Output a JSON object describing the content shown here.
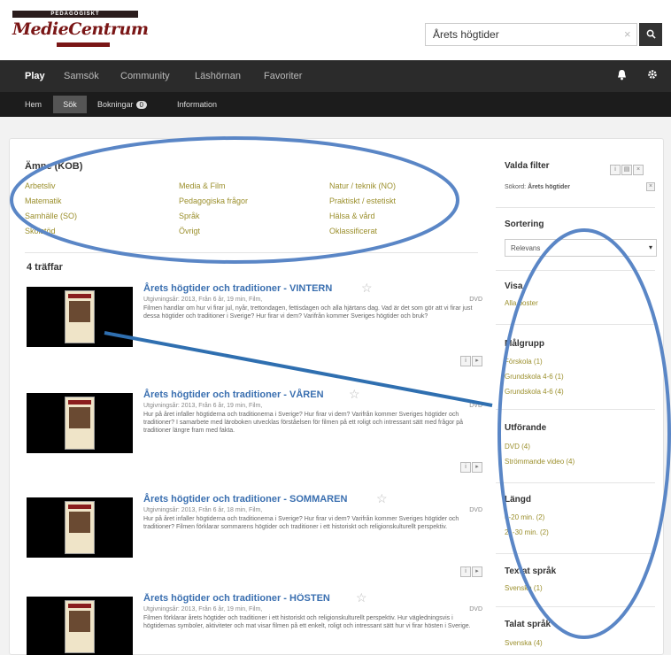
{
  "header": {
    "logo_top": "PEDAGOGISKT",
    "logo_script": "MedieCentrum",
    "search_value": "Årets högtider",
    "search_clear": "×",
    "search_icon": "search-icon"
  },
  "nav": {
    "items": [
      "Play",
      "Samsök",
      "Community",
      "Läshörnan",
      "Favoriter"
    ],
    "bell_icon": "bell-icon",
    "gear_icon": "gear-icon"
  },
  "subnav": {
    "items": [
      "Hem",
      "Sök",
      "Bokningar",
      "Information"
    ],
    "badge": "0"
  },
  "categories": {
    "title": "Ämne (KOB)",
    "links": [
      "Arbetsliv",
      "Media & Film",
      "Natur / teknik (NO)",
      "Matematik",
      "Pedagogiska frågor",
      "Praktiskt / estetiskt",
      "Samhälle (SO)",
      "Språk",
      "Hälsa & vård",
      "Skolstöd",
      "Övrigt",
      "Oklassificerat"
    ]
  },
  "results": {
    "count": "4 träffar",
    "items": [
      {
        "title": "Årets högtider och traditioner - VINTERN",
        "meta": "Utgivningsår: 2013, Från 6 år, 19 min, Film,",
        "dvd": "DVD",
        "desc": "Filmen handlar om hur vi firar jul, nyår, trettondagen, fettisdagen och alla hjärtans dag. Vad är det som gör att vi firar just dessa högtider och traditioner i Sverige? Hur firar vi dem? Varifrån kommer Sveriges högtider och bruk?"
      },
      {
        "title": "Årets högtider och traditioner - VÅREN",
        "meta": "Utgivningsår: 2013, Från 6 år, 19 min, Film,",
        "dvd": "DVD",
        "desc": "Hur på året infaller högtiderna och traditionerna i Sverige? Hur firar vi dem? Varifrån kommer Sveriges högtider och traditioner? I samarbete med läroboken utvecklas förståelsen för filmen på ett roligt och intressant sätt med frågor på traditioner längre fram med fakta."
      },
      {
        "title": "Årets högtider och traditioner - SOMMAREN",
        "meta": "Utgivningsår: 2013, Från 6 år, 18 min, Film,",
        "dvd": "DVD",
        "desc": "Hur på året infaller högtiderna och traditionerna i Sverige? Hur firar vi dem? Varifrån kommer Sveriges högtider och traditioner? Filmen förklarar sommarens högtider och traditioner i ett historiskt och religionskulturellt perspektiv."
      },
      {
        "title": "Årets högtider och traditioner - HÖSTEN",
        "meta": "Utgivningsår: 2013, Från 6 år, 19 min, Film,",
        "dvd": "DVD",
        "desc": "Filmen förklarar årets högtider och traditioner i ett historiskt och religionskulturellt perspektiv. Hur vägledningsvis i högtidernas symboler, aktiviteter och mat visar filmen på ett enkelt, roligt och intressant sätt hur vi firar hösten i Sverige."
      }
    ]
  },
  "sidebar": {
    "filters_title": "Valda filter",
    "filter_label": "Sökord:",
    "filter_value": "Årets högtider",
    "sort_title": "Sortering",
    "sort_value": "Relevans",
    "view_title": "Visa",
    "view_link": "Alla poster",
    "audience_title": "Målgrupp",
    "audience": [
      "Förskola (1)",
      "Grundskola 4-6 (1)",
      "Grundskola 4-6 (4)"
    ],
    "format_title": "Utförande",
    "format": [
      "DVD (4)",
      "Strömmande video (4)"
    ],
    "length_title": "Längd",
    "length": [
      "0-20 min. (2)",
      "21-30 min. (2)"
    ],
    "subs_title": "Textat språk",
    "subs": [
      "Svenska (1)"
    ],
    "spoken_title": "Talat språk",
    "spoken": [
      "Svenska (4)"
    ]
  },
  "colors": {
    "annotation": "#5a86c6",
    "nav_bg": "#2b2b2b",
    "link": "#9b8f2c",
    "title": "#3a6fb0"
  }
}
